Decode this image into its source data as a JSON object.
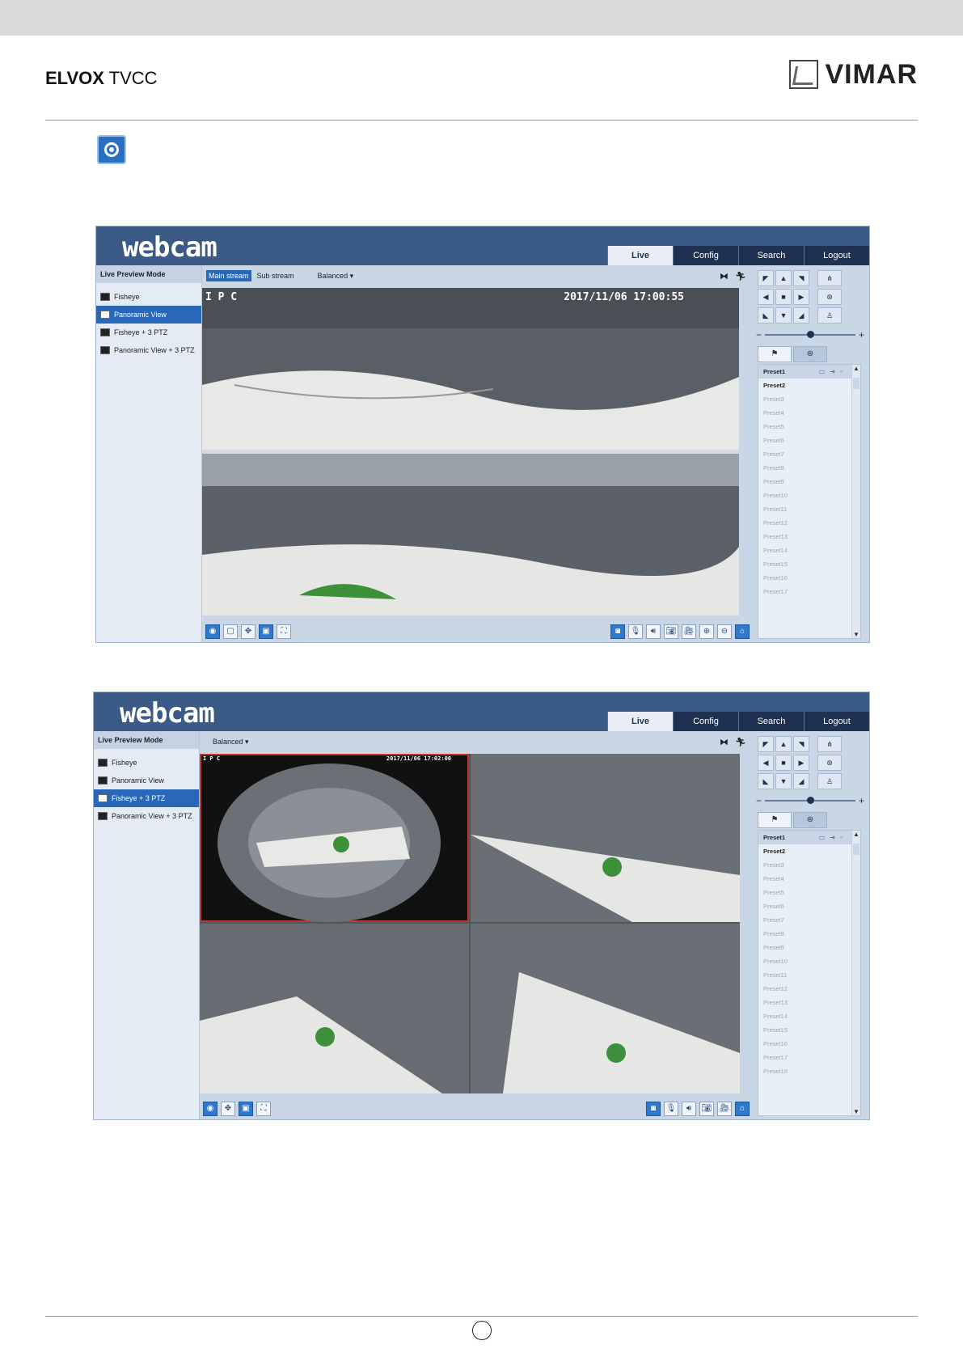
{
  "doc": {
    "brand_bold": "ELVOX",
    "brand_light": "TVCC",
    "logo_text": "VIMAR"
  },
  "shot1": {
    "app_logo": "webcam",
    "tabs": [
      "Live",
      "Config",
      "Search",
      "Logout"
    ],
    "sidebar_title": "Live Preview Mode",
    "sidebar_items": [
      "Fisheye",
      "Panoramic View",
      "Fisheye + 3 PTZ",
      "Panoramic View + 3 PTZ"
    ],
    "stream_main": "Main stream",
    "stream_sub": "Sub stream",
    "quality": "Balanced",
    "osd_label": "I P C",
    "osd_time": "2017/11/06 17:00:55",
    "presets": [
      "Preset1",
      "Preset2",
      "Preset3",
      "Preset4",
      "Preset5",
      "Preset6",
      "Preset7",
      "Preset8",
      "Preset9",
      "Preset10",
      "Preset11",
      "Preset12",
      "Preset13",
      "Preset14",
      "Preset15",
      "Preset16",
      "Preset17"
    ]
  },
  "shot2": {
    "app_logo": "webcam",
    "tabs": [
      "Live",
      "Config",
      "Search",
      "Logout"
    ],
    "sidebar_title": "Live Preview Mode",
    "sidebar_items": [
      "Fisheye",
      "Panoramic View",
      "Fisheye + 3 PTZ",
      "Panoramic View + 3 PTZ"
    ],
    "quality": "Balanced",
    "osd_label": "I P C",
    "osd_time": "2017/11/06 17:02:00",
    "presets": [
      "Preset1",
      "Preset2",
      "Preset3",
      "Preset4",
      "Preset5",
      "Preset6",
      "Preset7",
      "Preset8",
      "Preset9",
      "Preset10",
      "Preset11",
      "Preset12",
      "Preset13",
      "Preset14",
      "Preset15",
      "Preset16",
      "Preset17",
      "Preset18"
    ]
  }
}
